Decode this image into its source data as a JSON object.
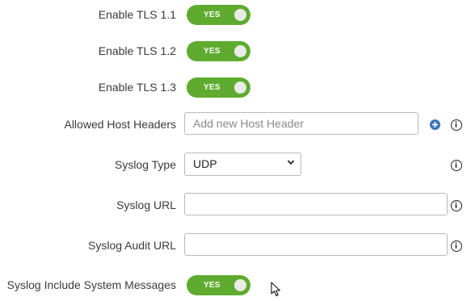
{
  "settings": {
    "tls11": {
      "label": "Enable TLS 1.1",
      "toggle": "YES"
    },
    "tls12": {
      "label": "Enable TLS 1.2",
      "toggle": "YES"
    },
    "tls13": {
      "label": "Enable TLS 1.3",
      "toggle": "YES"
    },
    "host_headers": {
      "label": "Allowed Host Headers",
      "placeholder": "Add new Host Header"
    },
    "syslog_type": {
      "label": "Syslog Type",
      "value": "UDP"
    },
    "syslog_url": {
      "label": "Syslog URL",
      "value": ""
    },
    "syslog_audit_url": {
      "label": "Syslog Audit URL",
      "value": ""
    },
    "syslog_system_msgs": {
      "label": "Syslog Include System Messages",
      "toggle": "YES"
    }
  },
  "icons": {
    "info": "info-circle-icon",
    "add": "plus-circle-icon",
    "cursor": "mouse-pointer-icon"
  },
  "colors": {
    "toggle_on": "#5fab2f",
    "add_icon": "#3a74b8"
  }
}
